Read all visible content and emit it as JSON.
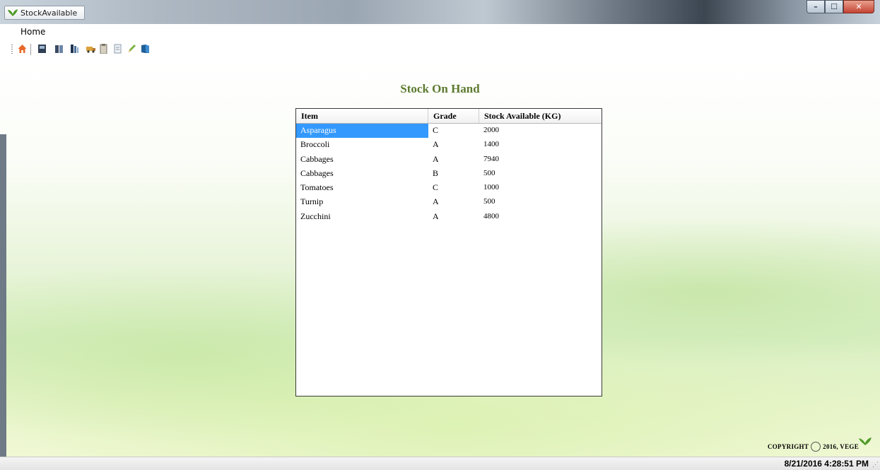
{
  "window": {
    "title": "StockAvailable",
    "controls": {
      "minimize": "–",
      "maximize": "☐",
      "close": "✕"
    }
  },
  "menu": {
    "items": [
      {
        "label": "Home"
      }
    ]
  },
  "toolbar": {
    "icons": [
      "home-icon",
      "report-icon",
      "customers-icon",
      "books-icon",
      "truck-icon",
      "clipboard-icon",
      "document-icon",
      "pencil-icon",
      "book-icon"
    ]
  },
  "page": {
    "title": "Stock On Hand"
  },
  "table": {
    "columns": [
      "Item",
      "Grade",
      "Stock Available (KG)"
    ],
    "rows": [
      {
        "item": "Asparagus",
        "grade": "C",
        "stock": "2000",
        "selected": true
      },
      {
        "item": "Broccoli",
        "grade": "A",
        "stock": "1400"
      },
      {
        "item": "Cabbages",
        "grade": "A",
        "stock": "7940"
      },
      {
        "item": "Cabbages",
        "grade": "B",
        "stock": "500"
      },
      {
        "item": "Tomatoes",
        "grade": "C",
        "stock": "1000"
      },
      {
        "item": "Turnip",
        "grade": "A",
        "stock": "500"
      },
      {
        "item": "Zucchini",
        "grade": "A",
        "stock": "4800"
      }
    ]
  },
  "footer": {
    "copyright_word": "COPYRIGHT",
    "copyright_rest": "2016, VEGE"
  },
  "status": {
    "datetime": "8/21/2016 4:28:51 PM"
  },
  "colors": {
    "title_green": "#5c7a2e",
    "selection": "#3399ff"
  }
}
